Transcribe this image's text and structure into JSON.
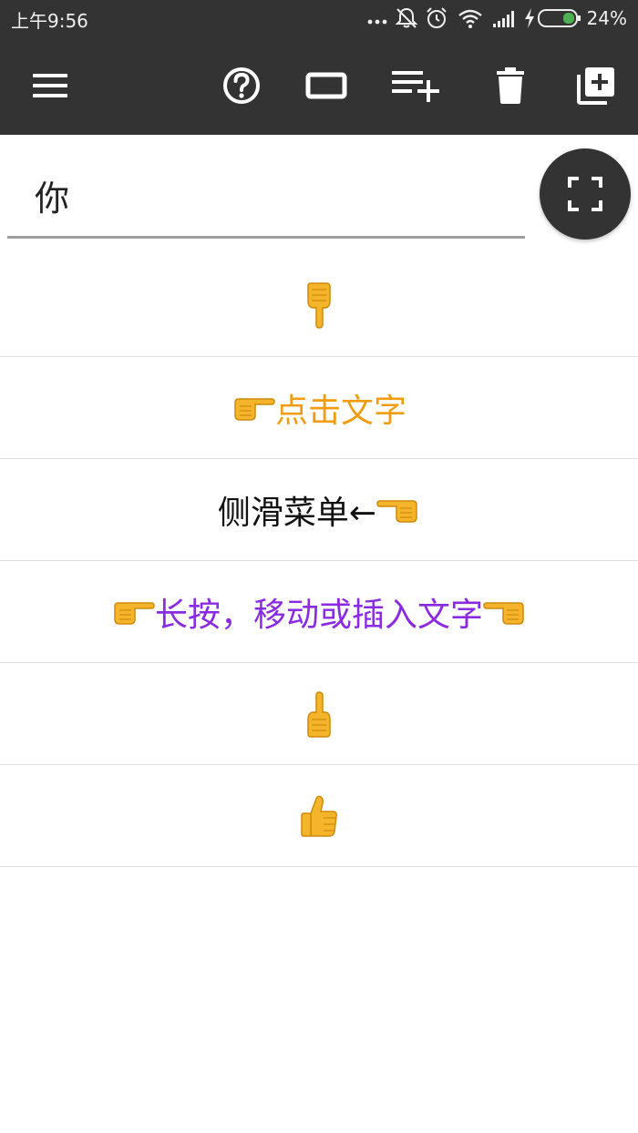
{
  "status_bar": {
    "time": "上午9:56",
    "battery": "24%"
  },
  "toolbar": {
    "icons": [
      "menu-icon",
      "help-icon",
      "rectangle-icon",
      "playlist-add-icon",
      "delete-icon",
      "library-add-icon"
    ]
  },
  "input": {
    "value": "你"
  },
  "fab": {
    "icon": "fullscreen-icon"
  },
  "list": {
    "items": [
      {
        "text": "",
        "color": "#000000",
        "prefix": "",
        "suffix": "",
        "emoji": "point-down"
      },
      {
        "text": "点击文字",
        "color": "#f39c12",
        "prefix": "point-right",
        "suffix": ""
      },
      {
        "text": "侧滑菜单←",
        "color": "#111111",
        "prefix": "",
        "suffix": "point-left"
      },
      {
        "text": "长按，移动或插入文字",
        "color": "#8a2be2",
        "prefix": "point-right",
        "suffix": "point-left"
      },
      {
        "text": "",
        "color": "#000000",
        "prefix": "",
        "suffix": "",
        "emoji": "point-up"
      },
      {
        "text": "",
        "color": "#000000",
        "prefix": "",
        "suffix": "",
        "emoji": "thumbs-up"
      }
    ]
  },
  "colors": {
    "toolbar_bg": "#333333",
    "hand": "#f5b52b",
    "accent_orange": "#f39c12",
    "accent_purple": "#8a2be2"
  }
}
